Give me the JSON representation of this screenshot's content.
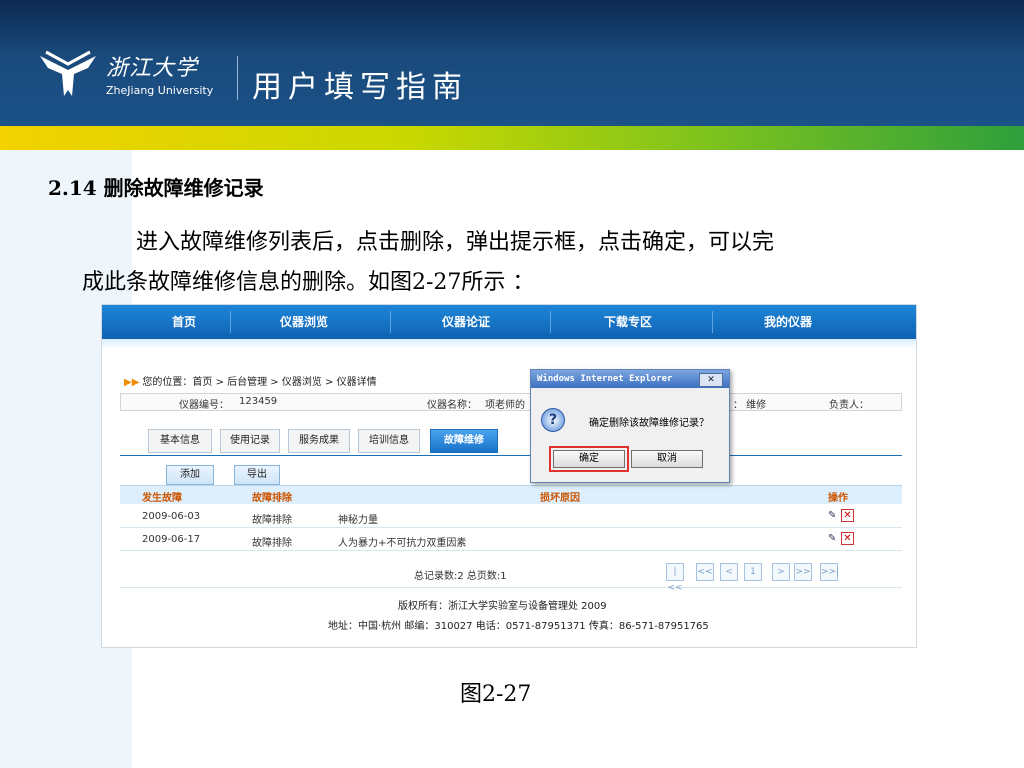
{
  "header": {
    "logo_cn": "浙江大学",
    "logo_en": "ZheJiang University",
    "title": "用户填写指南"
  },
  "section": {
    "heading": "2.14 删除故障维修记录"
  },
  "body": {
    "para_line1": "进入故障维修列表后，点击删除，弹出提示框，点击确定，可以完",
    "para_line2": "成此条故障维修信息的删除。如图2-27所示 ："
  },
  "caption": "图2-27",
  "screenshot": {
    "nav": [
      "首页",
      "仪器浏览",
      "仪器论证",
      "下载专区",
      "我的仪器"
    ],
    "breadcrumb": "您的位置：首页 > 后台管理 > 仪器浏览 > 仪器详情",
    "info": {
      "id_label": "仪器编号：",
      "id_value": "123459",
      "name_label": "仪器名称：",
      "name_value": "项老师的",
      "status_value": "：  维修",
      "owner_label": "负责人："
    },
    "tabs": [
      "基本信息",
      "使用记录",
      "服务成果",
      "培训信息",
      "故障维修"
    ],
    "buttons": {
      "add": "添加",
      "export": "导出"
    },
    "table": {
      "headers": [
        "发生故障",
        "故障排除",
        "损坏原因",
        "操作"
      ],
      "rows": [
        {
          "date": "2009-06-03",
          "status": "故障排除",
          "reason": "神秘力量"
        },
        {
          "date": "2009-06-17",
          "status": "故障排除",
          "reason": "人为暴力+不可抗力双重因素"
        }
      ]
    },
    "pager": {
      "summary": "总记录数:2 总页数:1",
      "buttons": [
        "|<<",
        "<<",
        "<",
        "1",
        ">",
        ">>",
        ">>|"
      ]
    },
    "footer": {
      "copyright": "版权所有：浙江大学实验室与设备管理处  2009",
      "address": "地址：中国·杭州  邮编：310027 电话：0571-87951371 传真：86-571-87951765"
    },
    "dialog": {
      "title": "Windows Internet Explorer",
      "close": "✕",
      "icon": "?",
      "message": "确定删除该故障维修记录？",
      "ok": "确定",
      "cancel": "取消"
    }
  }
}
